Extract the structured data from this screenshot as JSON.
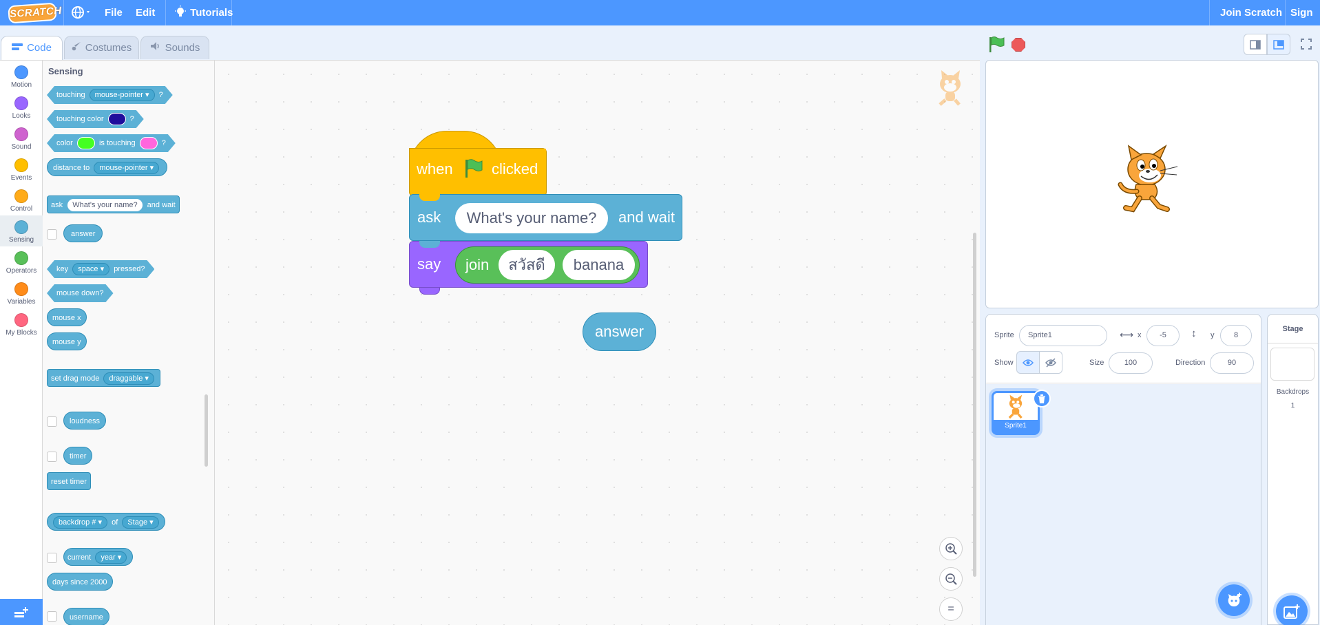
{
  "menubar": {
    "logo": "SCRATCH",
    "items": [
      "File",
      "Edit"
    ],
    "tutorials": "Tutorials",
    "join": "Join Scratch",
    "signin": "Sign in",
    "language_icon": "globe-icon"
  },
  "tabs": [
    {
      "label": "Code",
      "icon": "code-icon"
    },
    {
      "label": "Costumes",
      "icon": "brush-icon"
    },
    {
      "label": "Sounds",
      "icon": "speaker-icon"
    }
  ],
  "categories": [
    {
      "label": "Motion",
      "color": "#4c97ff"
    },
    {
      "label": "Looks",
      "color": "#9966ff"
    },
    {
      "label": "Sound",
      "color": "#cf63cf"
    },
    {
      "label": "Events",
      "color": "#ffbf00"
    },
    {
      "label": "Control",
      "color": "#ffab19"
    },
    {
      "label": "Sensing",
      "color": "#5cb1d6"
    },
    {
      "label": "Operators",
      "color": "#59c059"
    },
    {
      "label": "Variables",
      "color": "#ff8c1a"
    },
    {
      "label": "My Blocks",
      "color": "#ff6680"
    }
  ],
  "palette": {
    "title": "Sensing",
    "touching": "touching",
    "mouse_pointer": "mouse-pointer",
    "q": "?",
    "touching_color": "touching color",
    "color": "color",
    "is_touching": "is touching",
    "distance_to": "distance to",
    "ask": "ask",
    "ask_default": "What's your name?",
    "and_wait": "and wait",
    "answer": "answer",
    "key": "key",
    "space": "space",
    "pressed": "pressed?",
    "mouse_down": "mouse down?",
    "mouse_x": "mouse x",
    "mouse_y": "mouse y",
    "set_drag_mode": "set drag mode",
    "draggable": "draggable",
    "loudness": "loudness",
    "timer": "timer",
    "reset_timer": "reset timer",
    "backdrop_num": "backdrop #",
    "of": "of",
    "stage": "Stage",
    "current": "current",
    "year": "year",
    "days_since": "days since 2000",
    "username": "username",
    "swatch_colors": {
      "touching_color": "#1f0d9c",
      "color1": "#44ff22",
      "color2": "#ff66dd"
    }
  },
  "script": {
    "when": "when",
    "clicked": "clicked",
    "ask": "ask",
    "ask_value": "What's your name?",
    "and_wait": "and wait",
    "say": "say",
    "join": "join",
    "join_a": "สวัสดี",
    "join_b": "banana",
    "answer": "answer",
    "zoom_in": "+",
    "zoom_out": "−",
    "zoom_reset": "="
  },
  "sprite": {
    "sprite_label": "Sprite",
    "name": "Sprite1",
    "x_label": "x",
    "x": "-5",
    "y_label": "y",
    "y": "8",
    "show_label": "Show",
    "size_label": "Size",
    "size": "100",
    "direction_label": "Direction",
    "direction": "90",
    "thumb_name": "Sprite1"
  },
  "stage_pane": {
    "title": "Stage",
    "backdrops_label": "Backdrops",
    "backdrops_count": "1"
  }
}
